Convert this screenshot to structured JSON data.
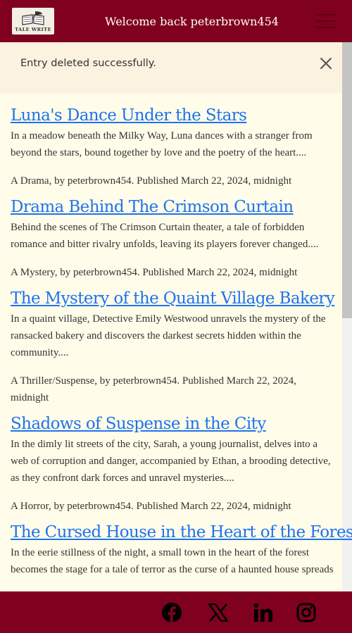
{
  "header": {
    "logo_text": "TALE WRITE",
    "welcome": "Welcome back peterbrown454",
    "menu_icon": "hamburger-menu-icon",
    "color": "#800020"
  },
  "alert": {
    "message": "Entry deleted successfully.",
    "close_icon": "close-icon"
  },
  "entries": [
    {
      "title": "Luna's Dance Under the Stars",
      "summary": "In a meadow beneath the Milky Way, Luna dances with a stranger from beyond the stars, bound together by love and the poetry of the heart....",
      "meta": "A Drama, by peterbrown454. Published March 22, 2024, midnight"
    },
    {
      "title": "Drama Behind The Crimson Curtain",
      "summary": "Behind the scenes of The Crimson Curtain theater, a tale of forbidden romance and bitter rivalry unfolds, leaving its players forever changed....",
      "meta": "A Mystery, by peterbrown454. Published March 22, 2024, midnight"
    },
    {
      "title": "The Mystery of the Quaint Village Bakery",
      "summary": "In a quaint village, Detective Emily Westwood unravels the mystery of the ransacked bakery and discovers the darkest secrets hidden within the community....",
      "meta": "A Thriller/Suspense, by peterbrown454. Published March 22, 2024, midnight"
    },
    {
      "title": "Shadows of Suspense in the City",
      "summary": "In the dimly lit streets of the city, Sarah, a young journalist, delves into a web of corruption and danger, accompanied by Ethan, a brooding detective, as they confront dark forces and unravel mysteries....",
      "meta": "A Horror, by peterbrown454. Published March 22, 2024, midnight"
    },
    {
      "title": "The Cursed House in the Heart of the Forest",
      "summary": "In the eerie stillness of the night, a small town in the heart of the forest becomes the stage for a tale of terror as the curse of a haunted house spreads",
      "meta": ""
    }
  ],
  "footer": {
    "icons": [
      "facebook-icon",
      "x-icon",
      "linkedin-icon",
      "instagram-icon"
    ]
  },
  "colors": {
    "primary": "#800020",
    "link": "#1e72f0",
    "background": "#fffde9",
    "alert_bg": "#fbf2e0"
  }
}
